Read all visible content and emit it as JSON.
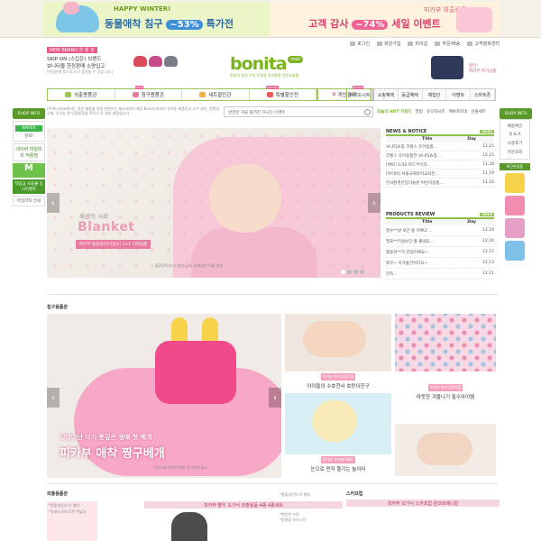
{
  "top_banner": {
    "left": {
      "line1": "HAPPY WINTER!",
      "line2": "동물애착 침구",
      "percent": "~53%",
      "suffix": "특가전"
    },
    "right": {
      "line1": "피카부 외출용품",
      "line2": "고객 감사",
      "percent": "~74%",
      "suffix": "세일 이벤트"
    }
  },
  "top_links": [
    "로그인",
    "회원가입",
    "마이샵",
    "주문/배송",
    "고객행복센터"
  ],
  "new_brand": {
    "tag": "NEW BRAND 한 정 판",
    "line1": "SKIP ON (스킵온) 브랜드",
    "line2": "보니타몰 한정판매 소량입고",
    "line3": "(한정판매 품으로 조기 품절될 수 있습니다.)"
  },
  "logo": {
    "name": "bonita",
    "badge": "mall",
    "slogan": "알뜰히 빛의 가치 친환경 유아용품 전문쇼핑몰"
  },
  "right_promo": {
    "text1": "할인!",
    "text2": "피카부 특가상품"
  },
  "nav_main": [
    {
      "label": "외출용품관",
      "badge": ""
    },
    {
      "label": "침구용품관",
      "badge": "best"
    },
    {
      "label": "세트할인관",
      "badge": ""
    },
    {
      "label": "특별할인전",
      "badge": "special"
    }
  ],
  "nav_sub": [
    {
      "label": "개인결제",
      "badge": ""
    },
    {
      "label": "아기도시트",
      "badge": "brand"
    }
  ],
  "nav_right": [
    "쇼핑혜택",
    "등급혜택",
    "체험단",
    "이벤트",
    "스마트폰"
  ],
  "shop_info_left": {
    "head": "SHOP INFO",
    "naver": "NAVER",
    "search": "검색!",
    "naver_text": "네이버 마일리지 적용점",
    "m_icon": "M",
    "pay_btn": "적립금 사용불 동시이벤트",
    "mileage": "마일리지 안내"
  },
  "info_text": "(주)보니타씨에서는 좋은 제품을 적정 한편으는 제조사와의 제휴 Brand 피카부 유아동 제품전공 소수 생산, 친환경소재, 유기농 한 인정받음을 목적으 로 생산 설립입니다.",
  "search": {
    "placeholder": "알알한 겨울 볼꺼진 하니다 이벤트"
  },
  "hot_keywords": {
    "label": "오늘의 HOT 키워드",
    "items": [
      "필링",
      "유모차시트",
      "매싸포르네",
      "선물세트"
    ]
  },
  "hero": {
    "caption1": "패션의 시작",
    "caption2": "Blanket",
    "caption3": "피카부 블랭킷(아기담요) 1+1 기획상품",
    "caption4": "블랑킷이 아니 패션 담요, 동화같은 이불 완성",
    "arrow_prev": "‹",
    "arrow_next": "›"
  },
  "news": {
    "title": "NEWS & NOTICE",
    "more": "MORE",
    "col_title": "Title",
    "col_day": "Day",
    "rows": [
      {
        "title": "보니타쇼핑 코렌스 유아용품...",
        "day": "12.15"
      },
      {
        "title": "코렌스 유아용품전 보니타쇼핑...",
        "day": "12.15"
      },
      {
        "title": "[체박] 1/30 카드무이자...",
        "day": "11.28"
      },
      {
        "title": "[하이바] 서울국제유아교육전...",
        "day": "11.19"
      },
      {
        "title": "한국환경산업기술원 어린이용품...",
        "day": "11.16"
      }
    ]
  },
  "reviews": {
    "title": "PRODUCTS REVIEW",
    "more": "MORE",
    "col_title": "Title",
    "col_day": "Day",
    "rows": [
      {
        "title": "필수**넷 보단 볼 이쁘고 ...",
        "day": "12.19"
      },
      {
        "title": "필로**키넷보단 활 좋네요...",
        "day": "12.16"
      },
      {
        "title": "활용성**가 만점이에요~",
        "day": "12.15"
      },
      {
        "title": "외우~ 아가물건이라요~",
        "day": "12.13"
      },
      {
        "title": "만족...",
        "day": "12.11"
      }
    ]
  },
  "shop_info_right": {
    "head": "SHOP INFO",
    "items": [
      "배송확인",
      "Q & A",
      "사용후기",
      "주문조회"
    ],
    "recent": "최근본상품"
  },
  "bedding": {
    "title": "침구용품관",
    "main": {
      "caption1": "갓태어난 아기 뜻깊은 생애 첫 베개",
      "caption2": "피카부 애착 짱구베개",
      "caption3": "건설모체 피카부 애착 짱구베개 출시",
      "arrow_prev": "‹",
      "arrow_next": "›"
    },
    "tiles": [
      {
        "tag": "피카부 아기낮잠이불",
        "title": "아이들의 수호천사 호랑이친구"
      },
      {
        "tag": "피카부 아기낮잠이불",
        "title": "따뜻한 겨울나기 필수아이템"
      },
      {
        "tag": "피카부 유아놀이매트",
        "title": "눈으로 먼저 즐기는 놀이터"
      }
    ]
  },
  "outing": {
    "title": "외출용품관",
    "text1": "*알뜰지/킨드가 뱅지",
    "text2": "*유래식 보드로쿠 폭넓고",
    "band": "피카부 빨우 오가닉 외출용품 4종 4종세트",
    "text3": "*알뜰지/킨드가 뱅지",
    "text4": "*편안한 수면",
    "text5": "*방향을 자유시작"
  },
  "skip_hope": {
    "title": "스카프럽",
    "band": "피카부 오가닉 스카프럽 원코트배니알"
  },
  "colors": {
    "accent": "#7ab51d",
    "pink": "#e85a8c",
    "nav_border": "#9bc55b"
  },
  "icons": [
    "search-icon",
    "lock-icon",
    "user-icon",
    "cart-icon",
    "truck-icon",
    "headset-icon"
  ]
}
